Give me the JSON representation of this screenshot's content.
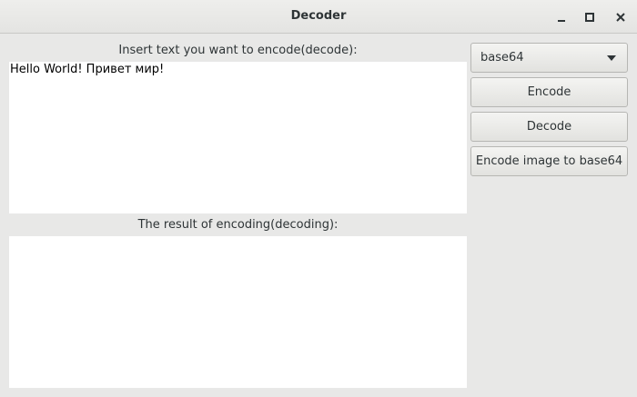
{
  "window": {
    "title": "Decoder"
  },
  "input": {
    "label": "Insert text you want to encode(decode):",
    "value": "Hello World! Привет мир!"
  },
  "output": {
    "label": "The result of encoding(decoding):",
    "value": ""
  },
  "controls": {
    "encoding_select": "base64",
    "encode_label": "Encode",
    "decode_label": "Decode",
    "encode_image_label": "Encode image to base64"
  },
  "icons": {
    "minimize": "minimize-icon",
    "maximize": "maximize-icon",
    "close": "close-icon",
    "dropdown": "chevron-down-icon"
  }
}
